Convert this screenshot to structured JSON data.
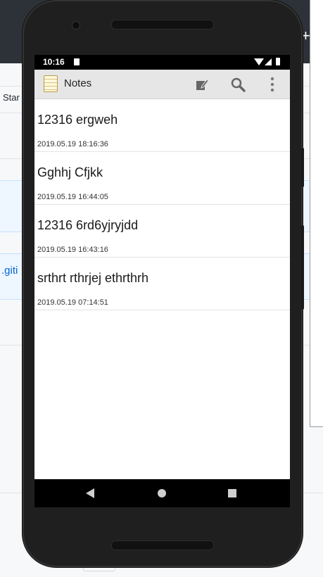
{
  "background": {
    "column_label": "Star",
    "link_text": ".giti",
    "plus_symbol": "+"
  },
  "status_bar": {
    "time": "10:16"
  },
  "action_bar": {
    "title": "Notes",
    "icons": [
      "notes-app-icon",
      "new-note-icon",
      "search-icon",
      "more-vert-icon"
    ]
  },
  "notes": [
    {
      "title": "12316 ergweh",
      "date": "2019.05.19 18:16:36"
    },
    {
      "title": "Gghhj Cfjkk",
      "date": "2019.05.19 16:44:05"
    },
    {
      "title": "12316 6rd6yjryjdd",
      "date": "2019.05.19 16:43:16"
    },
    {
      "title": "srthrt rthrjej ethrthrh",
      "date": "2019.05.19 07:14:51"
    }
  ],
  "colors": {
    "action_bar_bg": "#e6e6e6",
    "phone_frame": "#1f1f1f",
    "link_blue": "#0366d6"
  }
}
